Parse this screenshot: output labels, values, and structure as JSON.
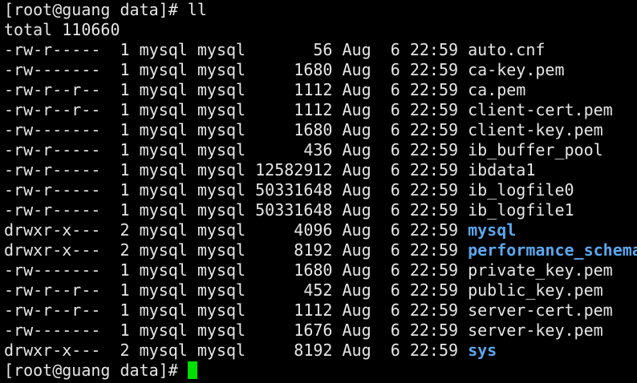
{
  "prompt_line": {
    "prompt": "[root@guang data]# ",
    "command": "ll"
  },
  "total_line": "total 110660",
  "entries": [
    {
      "permissions": "-rw-r-----",
      "links": "1",
      "owner": "mysql",
      "group": "mysql",
      "size": "56",
      "month": "Aug",
      "day": "6",
      "time": "22:59",
      "name": "auto.cnf",
      "is_dir": false
    },
    {
      "permissions": "-rw-------",
      "links": "1",
      "owner": "mysql",
      "group": "mysql",
      "size": "1680",
      "month": "Aug",
      "day": "6",
      "time": "22:59",
      "name": "ca-key.pem",
      "is_dir": false
    },
    {
      "permissions": "-rw-r--r--",
      "links": "1",
      "owner": "mysql",
      "group": "mysql",
      "size": "1112",
      "month": "Aug",
      "day": "6",
      "time": "22:59",
      "name": "ca.pem",
      "is_dir": false
    },
    {
      "permissions": "-rw-r--r--",
      "links": "1",
      "owner": "mysql",
      "group": "mysql",
      "size": "1112",
      "month": "Aug",
      "day": "6",
      "time": "22:59",
      "name": "client-cert.pem",
      "is_dir": false
    },
    {
      "permissions": "-rw-------",
      "links": "1",
      "owner": "mysql",
      "group": "mysql",
      "size": "1680",
      "month": "Aug",
      "day": "6",
      "time": "22:59",
      "name": "client-key.pem",
      "is_dir": false
    },
    {
      "permissions": "-rw-r-----",
      "links": "1",
      "owner": "mysql",
      "group": "mysql",
      "size": "436",
      "month": "Aug",
      "day": "6",
      "time": "22:59",
      "name": "ib_buffer_pool",
      "is_dir": false
    },
    {
      "permissions": "-rw-r-----",
      "links": "1",
      "owner": "mysql",
      "group": "mysql",
      "size": "12582912",
      "month": "Aug",
      "day": "6",
      "time": "22:59",
      "name": "ibdata1",
      "is_dir": false
    },
    {
      "permissions": "-rw-r-----",
      "links": "1",
      "owner": "mysql",
      "group": "mysql",
      "size": "50331648",
      "month": "Aug",
      "day": "6",
      "time": "22:59",
      "name": "ib_logfile0",
      "is_dir": false
    },
    {
      "permissions": "-rw-r-----",
      "links": "1",
      "owner": "mysql",
      "group": "mysql",
      "size": "50331648",
      "month": "Aug",
      "day": "6",
      "time": "22:59",
      "name": "ib_logfile1",
      "is_dir": false
    },
    {
      "permissions": "drwxr-x---",
      "links": "2",
      "owner": "mysql",
      "group": "mysql",
      "size": "4096",
      "month": "Aug",
      "day": "6",
      "time": "22:59",
      "name": "mysql",
      "is_dir": true
    },
    {
      "permissions": "drwxr-x---",
      "links": "2",
      "owner": "mysql",
      "group": "mysql",
      "size": "8192",
      "month": "Aug",
      "day": "6",
      "time": "22:59",
      "name": "performance_schema",
      "is_dir": true
    },
    {
      "permissions": "-rw-------",
      "links": "1",
      "owner": "mysql",
      "group": "mysql",
      "size": "1680",
      "month": "Aug",
      "day": "6",
      "time": "22:59",
      "name": "private_key.pem",
      "is_dir": false
    },
    {
      "permissions": "-rw-r--r--",
      "links": "1",
      "owner": "mysql",
      "group": "mysql",
      "size": "452",
      "month": "Aug",
      "day": "6",
      "time": "22:59",
      "name": "public_key.pem",
      "is_dir": false
    },
    {
      "permissions": "-rw-r--r--",
      "links": "1",
      "owner": "mysql",
      "group": "mysql",
      "size": "1112",
      "month": "Aug",
      "day": "6",
      "time": "22:59",
      "name": "server-cert.pem",
      "is_dir": false
    },
    {
      "permissions": "-rw-------",
      "links": "1",
      "owner": "mysql",
      "group": "mysql",
      "size": "1676",
      "month": "Aug",
      "day": "6",
      "time": "22:59",
      "name": "server-key.pem",
      "is_dir": false
    },
    {
      "permissions": "drwxr-x---",
      "links": "2",
      "owner": "mysql",
      "group": "mysql",
      "size": "8192",
      "month": "Aug",
      "day": "6",
      "time": "22:59",
      "name": "sys",
      "is_dir": true
    }
  ],
  "final_prompt": "[root@guang data]# ",
  "colors": {
    "background": "#000000",
    "text": "#e6e6e6",
    "directory": "#5aa7ef",
    "cursor": "#00e000"
  }
}
